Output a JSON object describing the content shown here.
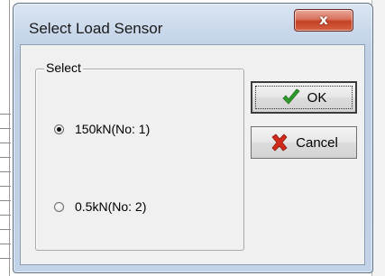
{
  "window": {
    "title": "Select Load Sensor",
    "close_glyph": "x"
  },
  "group": {
    "label": "Select",
    "options": [
      {
        "label": "150kN(No: 1)",
        "selected": true
      },
      {
        "label": "0.5kN(No: 2)",
        "selected": false
      }
    ]
  },
  "buttons": {
    "ok_label": "OK",
    "cancel_label": "Cancel",
    "ok_icon": "checkmark-icon",
    "cancel_icon": "red-x-icon"
  },
  "colors": {
    "ok_icon": "#2e9e2a",
    "cancel_icon": "#d22a1a",
    "close_button": "#c9482e"
  }
}
